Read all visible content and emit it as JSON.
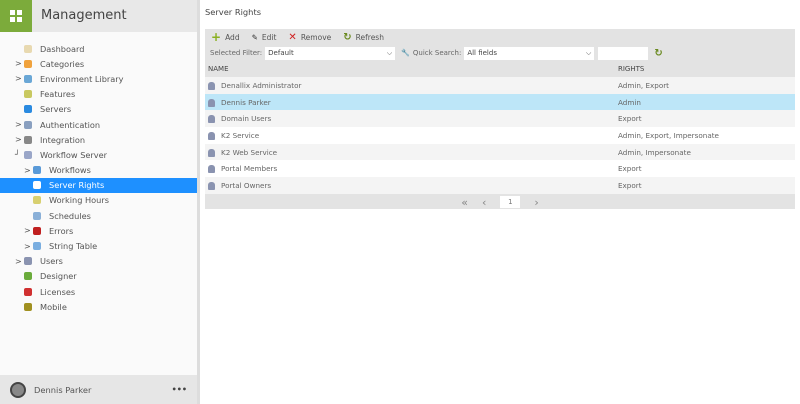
{
  "app": {
    "title": "Management"
  },
  "sidebar": {
    "items": [
      {
        "label": "Dashboard",
        "level": 0,
        "expand": "",
        "color": "#e8d9b0",
        "icon": "dashboard-icon"
      },
      {
        "label": "Categories",
        "level": 0,
        "expand": ">",
        "color": "#f0a23c",
        "icon": "folder-icon"
      },
      {
        "label": "Environment Library",
        "level": 0,
        "expand": ">",
        "color": "#6aa7d6",
        "icon": "library-icon"
      },
      {
        "label": "Features",
        "level": 0,
        "expand": "",
        "color": "#c8c860",
        "icon": "features-icon"
      },
      {
        "label": "Servers",
        "level": 0,
        "expand": "",
        "color": "#2a8ae0",
        "icon": "server-icon"
      },
      {
        "label": "Authentication",
        "level": 0,
        "expand": ">",
        "color": "#8aa0c0",
        "icon": "key-icon"
      },
      {
        "label": "Integration",
        "level": 0,
        "expand": ">",
        "color": "#888888",
        "icon": "puzzle-icon"
      },
      {
        "label": "Workflow Server",
        "level": 0,
        "expand": "┘",
        "color": "#9aa6c8",
        "icon": "workflow-server-icon"
      },
      {
        "label": "Workflows",
        "level": 1,
        "expand": ">",
        "color": "#5a9ad8",
        "icon": "workflow-icon"
      },
      {
        "label": "Server Rights",
        "level": 1,
        "expand": "",
        "color": "#ffffff",
        "icon": "lock-icon",
        "selected": true
      },
      {
        "label": "Working Hours",
        "level": 1,
        "expand": "",
        "color": "#d8d070",
        "icon": "clock-icon"
      },
      {
        "label": "Schedules",
        "level": 1,
        "expand": "",
        "color": "#8ab0d8",
        "icon": "schedule-icon"
      },
      {
        "label": "Errors",
        "level": 1,
        "expand": ">",
        "color": "#c02020",
        "icon": "error-icon"
      },
      {
        "label": "String Table",
        "level": 1,
        "expand": ">",
        "color": "#7aaee0",
        "icon": "string-table-icon"
      },
      {
        "label": "Users",
        "level": 0,
        "expand": ">",
        "color": "#8a93b0",
        "icon": "users-icon"
      },
      {
        "label": "Designer",
        "level": 0,
        "expand": "",
        "color": "#6aab3b",
        "icon": "designer-icon"
      },
      {
        "label": "Licenses",
        "level": 0,
        "expand": "",
        "color": "#d03030",
        "icon": "license-icon"
      },
      {
        "label": "Mobile",
        "level": 0,
        "expand": "",
        "color": "#a09020",
        "icon": "mobile-icon"
      }
    ]
  },
  "user": {
    "name": "Dennis Parker",
    "more": "•••"
  },
  "page": {
    "title": "Server Rights"
  },
  "toolbar": {
    "add": "Add",
    "edit": "Edit",
    "remove": "Remove",
    "refresh": "Refresh"
  },
  "filters": {
    "selected_filter_label": "Selected Filter:",
    "selected_filter_value": "Default",
    "quick_search_label": "Quick Search:",
    "quick_search_field": "All fields",
    "quick_search_value": ""
  },
  "table": {
    "columns": [
      "NAME",
      "RIGHTS"
    ],
    "rows": [
      {
        "name": "Denallix Administrator",
        "rights": "Admin, Export"
      },
      {
        "name": "Dennis Parker",
        "rights": "Admin",
        "selected": true
      },
      {
        "name": "Domain Users",
        "rights": "Export"
      },
      {
        "name": "K2 Service",
        "rights": "Admin, Export, Impersonate"
      },
      {
        "name": "K2 Web Service",
        "rights": "Admin, Impersonate"
      },
      {
        "name": "Portal Members",
        "rights": "Export"
      },
      {
        "name": "Portal Owners",
        "rights": "Export"
      }
    ]
  },
  "pager": {
    "page": "1"
  }
}
